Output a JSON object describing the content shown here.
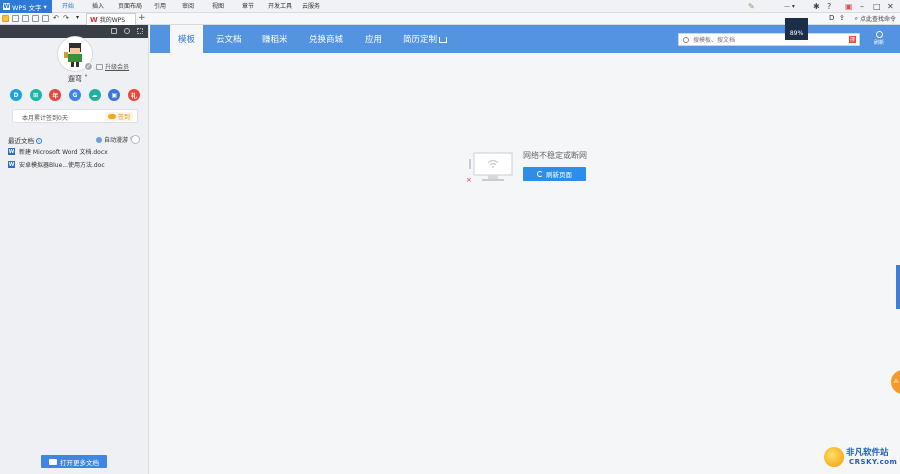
{
  "app": {
    "name": "WPS 文字",
    "menu": [
      "开始",
      "插入",
      "页面布局",
      "引用",
      "审阅",
      "视图",
      "章节",
      "开发工具",
      "云服务"
    ],
    "active_menu": "开始"
  },
  "toolbar": {
    "tab_label": "我的WPS",
    "new_tab": "+",
    "find_command": "点此查找命令"
  },
  "window_controls": {
    "help": "?",
    "minimize": "–",
    "restore": "□",
    "close": "✕"
  },
  "sidebar": {
    "username": "遛弯 ˚",
    "upgrade_label": "升级会员",
    "checkin_text": "本月累计签到0天",
    "checkin_button": "签到",
    "recent_title": "最近文档",
    "autorun_label": "自动漫游",
    "recent_files": [
      {
        "name": "新建 Microsoft Word 文档.docx"
      },
      {
        "name": "安卓模拟器Blue...使用方法.doc"
      }
    ],
    "open_more": "打开更多文档",
    "quick_icons": [
      {
        "icon": "d-icon",
        "glyph": "D",
        "color": "#1aa2e6"
      },
      {
        "icon": "grid-icon",
        "glyph": "⊞",
        "color": "#1cb7a7"
      },
      {
        "icon": "calendar-icon",
        "glyph": "年",
        "color": "#e8463a"
      },
      {
        "icon": "g-icon",
        "glyph": "G",
        "color": "#3f84e8"
      },
      {
        "icon": "cloud-icon",
        "glyph": "☁",
        "color": "#1db1a0"
      },
      {
        "icon": "lock-icon",
        "glyph": "▣",
        "color": "#3b76d8"
      },
      {
        "icon": "gift-icon",
        "glyph": "礼",
        "color": "#e8463a"
      }
    ]
  },
  "main": {
    "nav_tabs": [
      "模板",
      "云文档",
      "赚稻米",
      "兑换商城",
      "应用",
      "简历定制"
    ],
    "active_tab": "模板",
    "search_placeholder": "搜模板、搜文档",
    "search_go": "搜",
    "zoom": "89%",
    "refresh_label": "刷新",
    "network_message": "网络不稳定或断网",
    "reload_button": "刷新页面"
  },
  "watermark": {
    "cn": "非凡软件站",
    "en": "CRSKY.com"
  },
  "colors": {
    "accent": "#5393df",
    "app_blue": "#2d7ad6",
    "sidebar_dark": "#3a3e46",
    "reload": "#2c8ee8"
  }
}
